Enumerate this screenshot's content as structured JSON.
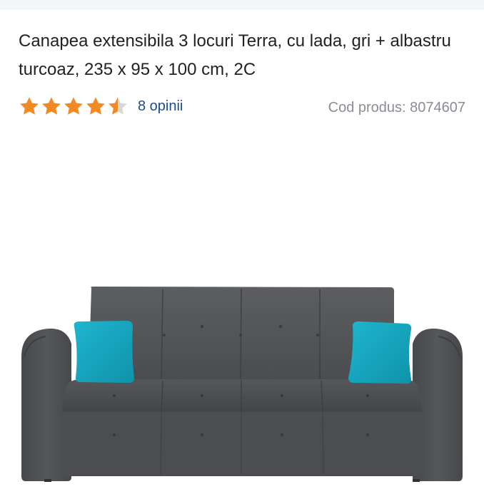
{
  "product": {
    "title": "Canapea extensibila 3 locuri Terra, cu lada, gri + albastru turcoaz, 235 x 95 x 100 cm, 2C",
    "rating": 4.5,
    "rating_max": 5,
    "reviews_label": "8 opinii",
    "code_label": "Cod produs: 8074607"
  },
  "colors": {
    "star": "#f08a24",
    "star_empty": "#d8d8d8",
    "link": "#1f4a8c",
    "sofa": "#545658",
    "pillow": "#14a6c0"
  },
  "icons": {
    "rating_star": "star-icon",
    "product_image": "sofa-image"
  }
}
